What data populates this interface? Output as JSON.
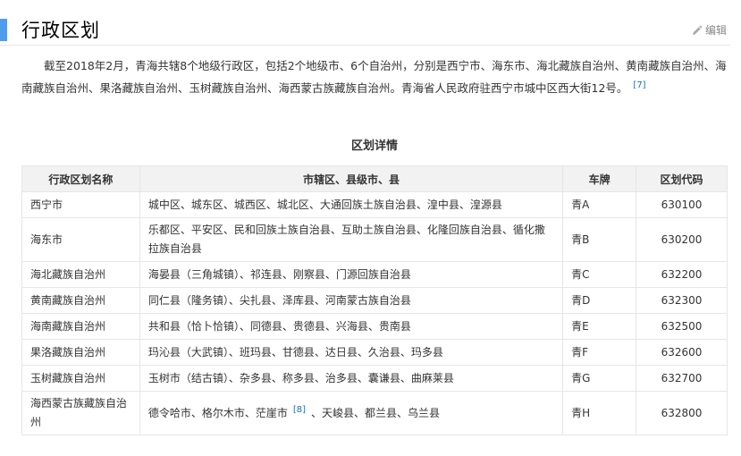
{
  "section": {
    "title": "行政区划",
    "edit_label": "编辑"
  },
  "intro": {
    "text": "截至2018年2月，青海共辖8个地级行政区，包括2个地级市、6个自治州，分别是西宁市、海东市、海北藏族自治州、黄南藏族自治州、海南藏族自治州、果洛藏族自治州、玉树藏族自治州、海西蒙古族藏族自治州。青海省人民政府驻西宁市城中区西大街12号。",
    "ref": "[7]"
  },
  "table": {
    "caption": "区划详情",
    "headers": [
      "行政区划名称",
      "市辖区、县级市、县",
      "车牌",
      "区划代码"
    ],
    "rows": [
      {
        "name": "西宁市",
        "divisions": "城中区、城东区、城西区、城北区、大通回族土族自治县、湟中县、湟源县",
        "plate": "青A",
        "code": "630100"
      },
      {
        "name": "海东市",
        "divisions": "乐都区、平安区、民和回族土族自治县、互助土族自治县、化隆回族自治县、循化撒拉族自治县",
        "plate": "青B",
        "code": "630200"
      },
      {
        "name": "海北藏族自治州",
        "divisions": "海晏县（三角城镇）、祁连县、刚察县、门源回族自治县",
        "plate": "青C",
        "code": "632200"
      },
      {
        "name": "黄南藏族自治州",
        "divisions": "同仁县（隆务镇）、尖扎县、泽库县、河南蒙古族自治县",
        "plate": "青D",
        "code": "632300"
      },
      {
        "name": "海南藏族自治州",
        "divisions": "共和县（恰卜恰镇）、同德县、贵德县、兴海县、贵南县",
        "plate": "青E",
        "code": "632500"
      },
      {
        "name": "果洛藏族自治州",
        "divisions": "玛沁县（大武镇）、班玛县、甘德县、达日县、久治县、玛多县",
        "plate": "青F",
        "code": "632600"
      },
      {
        "name": "玉树藏族自治州",
        "divisions": "玉树市（结古镇）、杂多县、称多县、治多县、囊谦县、曲麻莱县",
        "plate": "青G",
        "code": "632700"
      },
      {
        "name": "海西蒙古族藏族自治州",
        "divisions_pre": "德令哈市、格尔木市、茫崖市",
        "divisions_ref": "[8]",
        "divisions_post": "、天峻县、都兰县、乌兰县",
        "plate": "青H",
        "code": "632800"
      }
    ]
  }
}
